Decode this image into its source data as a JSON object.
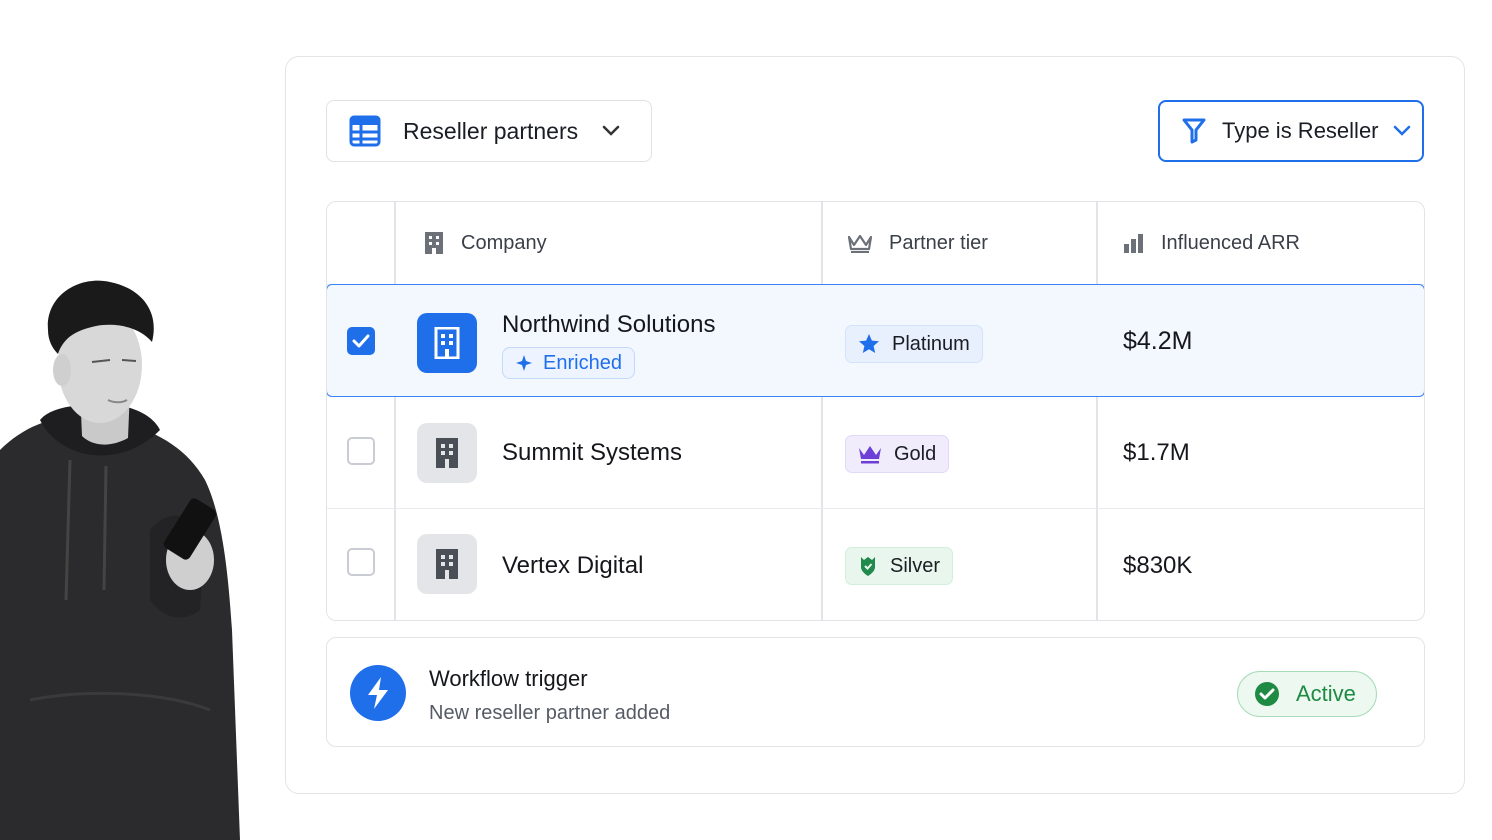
{
  "view": {
    "label": "Reseller partners",
    "icon": "table-icon"
  },
  "filter": {
    "label": "Type is Reseller",
    "icon": "filter-icon"
  },
  "table": {
    "columns": [
      {
        "label": "Company",
        "icon": "building-icon"
      },
      {
        "label": "Partner tier",
        "icon": "crown-icon"
      },
      {
        "label": "Influenced ARR",
        "icon": "bar-chart-icon"
      }
    ],
    "rows": [
      {
        "company": "Northwind Solutions",
        "badge": "Enriched",
        "tier": "Platinum",
        "tier_icon": "star-icon",
        "arr": "$4.2M",
        "selected": true
      },
      {
        "company": "Summit Systems",
        "tier": "Gold",
        "tier_icon": "crown-icon",
        "arr": "$1.7M",
        "selected": false
      },
      {
        "company": "Vertex Digital",
        "tier": "Silver",
        "tier_icon": "shield-icon",
        "arr": "$830K",
        "selected": false
      }
    ]
  },
  "workflow": {
    "title": "Workflow trigger",
    "subtitle": "New reseller partner added",
    "status": "Active"
  },
  "colors": {
    "accent": "#1f6feb",
    "active_green": "#1e8a43",
    "gold_purple": "#6d3fd6",
    "silver_green": "#1f8a4c"
  }
}
